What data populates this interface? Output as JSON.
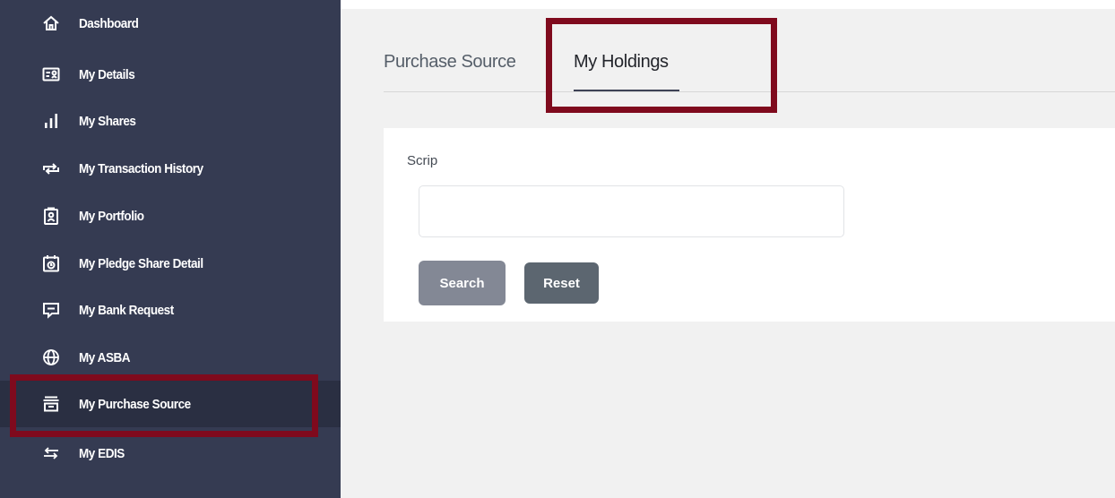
{
  "sidebar": {
    "items": [
      {
        "label": "Dashboard",
        "icon": "home-icon"
      },
      {
        "label": "My Details",
        "icon": "id-card-icon"
      },
      {
        "label": "My Shares",
        "icon": "bar-chart-icon"
      },
      {
        "label": "My Transaction History",
        "icon": "repeat-arrows-icon"
      },
      {
        "label": "My Portfolio",
        "icon": "clipboard-person-icon"
      },
      {
        "label": "My Pledge Share Detail",
        "icon": "calendar-clock-icon"
      },
      {
        "label": "My Bank Request",
        "icon": "message-icon"
      },
      {
        "label": "My ASBA",
        "icon": "globe-icon"
      },
      {
        "label": "My Purchase Source",
        "icon": "inbox-tray-icon"
      },
      {
        "label": "My EDIS",
        "icon": "exchange-arrows-icon"
      }
    ],
    "active_item": "My Purchase Source"
  },
  "tabs": [
    {
      "label": "Purchase Source"
    },
    {
      "label": "My Holdings"
    }
  ],
  "active_tab": "My Holdings",
  "form": {
    "scrip_label": "Scrip",
    "scrip_value": "",
    "search_label": "Search",
    "reset_label": "Reset"
  },
  "colors": {
    "sidebar_bg": "#353b52",
    "sidebar_active_bg": "#2a2f42",
    "highlight_border": "#7f0a1d",
    "search_button": "#838895",
    "reset_button": "#5c6670"
  }
}
